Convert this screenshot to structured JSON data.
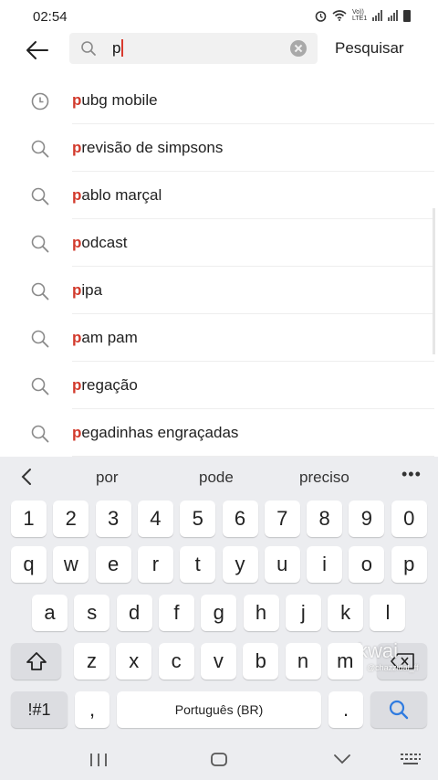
{
  "status_bar": {
    "time": "02:54",
    "network_label": "Vo))\nLTE1"
  },
  "search": {
    "query": "p",
    "submit_label": "Pesquisar"
  },
  "suggestions": [
    {
      "highlight": "p",
      "rest": "ubg mobile",
      "icon": "history-clock-icon"
    },
    {
      "highlight": "p",
      "rest": "revisão de simpsons",
      "icon": "search-icon"
    },
    {
      "highlight": "p",
      "rest": "ablo marçal",
      "icon": "search-icon"
    },
    {
      "highlight": "p",
      "rest": "odcast",
      "icon": "search-icon"
    },
    {
      "highlight": "p",
      "rest": "ipa",
      "icon": "search-icon"
    },
    {
      "highlight": "p",
      "rest": "am pam",
      "icon": "search-icon"
    },
    {
      "highlight": "p",
      "rest": "regação",
      "icon": "search-icon"
    },
    {
      "highlight": "p",
      "rest": "egadinhas engraçadas",
      "icon": "search-icon"
    }
  ],
  "keyboard": {
    "predictions": [
      "por",
      "pode",
      "preciso"
    ],
    "row_numbers": [
      "1",
      "2",
      "3",
      "4",
      "5",
      "6",
      "7",
      "8",
      "9",
      "0"
    ],
    "row_top": [
      "q",
      "w",
      "e",
      "r",
      "t",
      "y",
      "u",
      "i",
      "o",
      "p"
    ],
    "row_home": [
      "a",
      "s",
      "d",
      "f",
      "g",
      "h",
      "j",
      "k",
      "l"
    ],
    "row_bottom": [
      "z",
      "x",
      "c",
      "v",
      "b",
      "n",
      "m"
    ],
    "symbols_label": "!#1",
    "comma_label": ",",
    "space_label": "Português (BR)",
    "period_label": "."
  },
  "watermark": {
    "brand": "kwai",
    "handle": "@chazzidal_ff"
  },
  "colors": {
    "highlight": "#d23a2c",
    "search_accent": "#2f7be0",
    "keyboard_bg": "#ecedf0"
  }
}
